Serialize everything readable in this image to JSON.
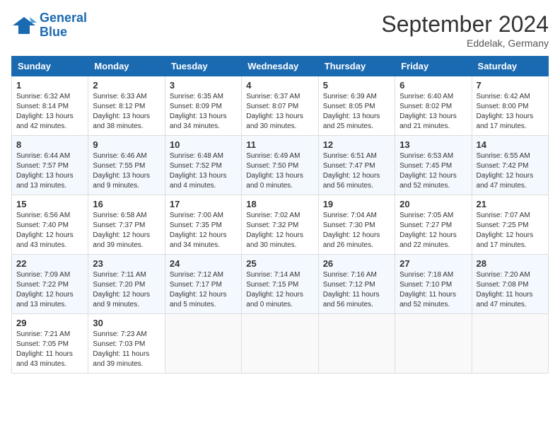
{
  "header": {
    "logo_line1": "General",
    "logo_line2": "Blue",
    "month_year": "September 2024",
    "location": "Eddelak, Germany"
  },
  "columns": [
    "Sunday",
    "Monday",
    "Tuesday",
    "Wednesday",
    "Thursday",
    "Friday",
    "Saturday"
  ],
  "weeks": [
    [
      {
        "day": "1",
        "info": "Sunrise: 6:32 AM\nSunset: 8:14 PM\nDaylight: 13 hours\nand 42 minutes."
      },
      {
        "day": "2",
        "info": "Sunrise: 6:33 AM\nSunset: 8:12 PM\nDaylight: 13 hours\nand 38 minutes."
      },
      {
        "day": "3",
        "info": "Sunrise: 6:35 AM\nSunset: 8:09 PM\nDaylight: 13 hours\nand 34 minutes."
      },
      {
        "day": "4",
        "info": "Sunrise: 6:37 AM\nSunset: 8:07 PM\nDaylight: 13 hours\nand 30 minutes."
      },
      {
        "day": "5",
        "info": "Sunrise: 6:39 AM\nSunset: 8:05 PM\nDaylight: 13 hours\nand 25 minutes."
      },
      {
        "day": "6",
        "info": "Sunrise: 6:40 AM\nSunset: 8:02 PM\nDaylight: 13 hours\nand 21 minutes."
      },
      {
        "day": "7",
        "info": "Sunrise: 6:42 AM\nSunset: 8:00 PM\nDaylight: 13 hours\nand 17 minutes."
      }
    ],
    [
      {
        "day": "8",
        "info": "Sunrise: 6:44 AM\nSunset: 7:57 PM\nDaylight: 13 hours\nand 13 minutes."
      },
      {
        "day": "9",
        "info": "Sunrise: 6:46 AM\nSunset: 7:55 PM\nDaylight: 13 hours\nand 9 minutes."
      },
      {
        "day": "10",
        "info": "Sunrise: 6:48 AM\nSunset: 7:52 PM\nDaylight: 13 hours\nand 4 minutes."
      },
      {
        "day": "11",
        "info": "Sunrise: 6:49 AM\nSunset: 7:50 PM\nDaylight: 13 hours\nand 0 minutes."
      },
      {
        "day": "12",
        "info": "Sunrise: 6:51 AM\nSunset: 7:47 PM\nDaylight: 12 hours\nand 56 minutes."
      },
      {
        "day": "13",
        "info": "Sunrise: 6:53 AM\nSunset: 7:45 PM\nDaylight: 12 hours\nand 52 minutes."
      },
      {
        "day": "14",
        "info": "Sunrise: 6:55 AM\nSunset: 7:42 PM\nDaylight: 12 hours\nand 47 minutes."
      }
    ],
    [
      {
        "day": "15",
        "info": "Sunrise: 6:56 AM\nSunset: 7:40 PM\nDaylight: 12 hours\nand 43 minutes."
      },
      {
        "day": "16",
        "info": "Sunrise: 6:58 AM\nSunset: 7:37 PM\nDaylight: 12 hours\nand 39 minutes."
      },
      {
        "day": "17",
        "info": "Sunrise: 7:00 AM\nSunset: 7:35 PM\nDaylight: 12 hours\nand 34 minutes."
      },
      {
        "day": "18",
        "info": "Sunrise: 7:02 AM\nSunset: 7:32 PM\nDaylight: 12 hours\nand 30 minutes."
      },
      {
        "day": "19",
        "info": "Sunrise: 7:04 AM\nSunset: 7:30 PM\nDaylight: 12 hours\nand 26 minutes."
      },
      {
        "day": "20",
        "info": "Sunrise: 7:05 AM\nSunset: 7:27 PM\nDaylight: 12 hours\nand 22 minutes."
      },
      {
        "day": "21",
        "info": "Sunrise: 7:07 AM\nSunset: 7:25 PM\nDaylight: 12 hours\nand 17 minutes."
      }
    ],
    [
      {
        "day": "22",
        "info": "Sunrise: 7:09 AM\nSunset: 7:22 PM\nDaylight: 12 hours\nand 13 minutes."
      },
      {
        "day": "23",
        "info": "Sunrise: 7:11 AM\nSunset: 7:20 PM\nDaylight: 12 hours\nand 9 minutes."
      },
      {
        "day": "24",
        "info": "Sunrise: 7:12 AM\nSunset: 7:17 PM\nDaylight: 12 hours\nand 5 minutes."
      },
      {
        "day": "25",
        "info": "Sunrise: 7:14 AM\nSunset: 7:15 PM\nDaylight: 12 hours\nand 0 minutes."
      },
      {
        "day": "26",
        "info": "Sunrise: 7:16 AM\nSunset: 7:12 PM\nDaylight: 11 hours\nand 56 minutes."
      },
      {
        "day": "27",
        "info": "Sunrise: 7:18 AM\nSunset: 7:10 PM\nDaylight: 11 hours\nand 52 minutes."
      },
      {
        "day": "28",
        "info": "Sunrise: 7:20 AM\nSunset: 7:08 PM\nDaylight: 11 hours\nand 47 minutes."
      }
    ],
    [
      {
        "day": "29",
        "info": "Sunrise: 7:21 AM\nSunset: 7:05 PM\nDaylight: 11 hours\nand 43 minutes."
      },
      {
        "day": "30",
        "info": "Sunrise: 7:23 AM\nSunset: 7:03 PM\nDaylight: 11 hours\nand 39 minutes."
      },
      {
        "day": "",
        "info": ""
      },
      {
        "day": "",
        "info": ""
      },
      {
        "day": "",
        "info": ""
      },
      {
        "day": "",
        "info": ""
      },
      {
        "day": "",
        "info": ""
      }
    ]
  ]
}
